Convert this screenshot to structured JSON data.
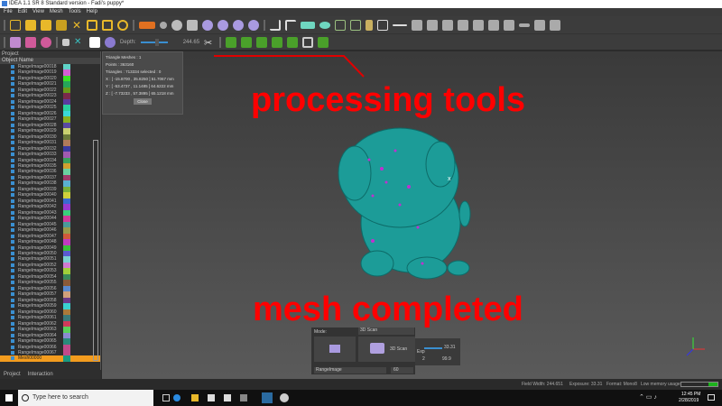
{
  "window": {
    "title": "IDEA 1.1 SR 8 Standard version - Fadi's puppy*"
  },
  "menu": [
    "File",
    "Edit",
    "View",
    "Mesh",
    "Tools",
    "Help"
  ],
  "toolbar2": {
    "depth_label": "Depth:",
    "depth_value": "244.65"
  },
  "project": {
    "header": "Project",
    "column": "Object Name",
    "items": [
      {
        "name": "RangeImage00018",
        "color": "#5fd3c8"
      },
      {
        "name": "RangeImage00019",
        "color": "#d45fd3"
      },
      {
        "name": "RangeImage00020",
        "color": "#3be026"
      },
      {
        "name": "RangeImage00021",
        "color": "#26a55a"
      },
      {
        "name": "RangeImage00022",
        "color": "#6a9a1a"
      },
      {
        "name": "RangeImage00023",
        "color": "#7a2a4a"
      },
      {
        "name": "RangeImage00024",
        "color": "#5a3aa0"
      },
      {
        "name": "RangeImage00025",
        "color": "#2ad0a0"
      },
      {
        "name": "RangeImage00026",
        "color": "#3ad8d8"
      },
      {
        "name": "RangeImage00027",
        "color": "#8ab020"
      },
      {
        "name": "RangeImage00028",
        "color": "#5a4aa0"
      },
      {
        "name": "RangeImage00029",
        "color": "#c8d070"
      },
      {
        "name": "RangeImage00030",
        "color": "#6a7a3a"
      },
      {
        "name": "RangeImage00031",
        "color": "#b07a5a"
      },
      {
        "name": "RangeImage00032",
        "color": "#3a3aa0"
      },
      {
        "name": "RangeImage00033",
        "color": "#a05ab0"
      },
      {
        "name": "RangeImage00034",
        "color": "#3aa05a"
      },
      {
        "name": "RangeImage00035",
        "color": "#d0a030"
      },
      {
        "name": "RangeImage00036",
        "color": "#6ad0a0"
      },
      {
        "name": "RangeImage00037",
        "color": "#a03a6a"
      },
      {
        "name": "RangeImage00038",
        "color": "#5ab0d0"
      },
      {
        "name": "RangeImage00039",
        "color": "#7ab03a"
      },
      {
        "name": "RangeImage00040",
        "color": "#d0d03a"
      },
      {
        "name": "RangeImage00041",
        "color": "#3a6ad0"
      },
      {
        "name": "RangeImage00042",
        "color": "#9a3ad0"
      },
      {
        "name": "RangeImage00043",
        "color": "#3ad07a"
      },
      {
        "name": "RangeImage00044",
        "color": "#d03a9a"
      },
      {
        "name": "RangeImage00045",
        "color": "#4a9a9a"
      },
      {
        "name": "RangeImage00046",
        "color": "#9a9a4a"
      },
      {
        "name": "RangeImage00047",
        "color": "#d05a3a"
      },
      {
        "name": "RangeImage00048",
        "color": "#c03ac0"
      },
      {
        "name": "RangeImage00049",
        "color": "#3ac03a"
      },
      {
        "name": "RangeImage00050",
        "color": "#5a5ad0"
      },
      {
        "name": "RangeImage00051",
        "color": "#7ad0d0"
      },
      {
        "name": "RangeImage00052",
        "color": "#d07ad0"
      },
      {
        "name": "RangeImage00053",
        "color": "#a0d03a"
      },
      {
        "name": "RangeImage00054",
        "color": "#3a8a5a"
      },
      {
        "name": "RangeImage00055",
        "color": "#8a5a3a"
      },
      {
        "name": "RangeImage00056",
        "color": "#5a8ad0"
      },
      {
        "name": "RangeImage00057",
        "color": "#d0a07a"
      },
      {
        "name": "RangeImage00058",
        "color": "#6a3a8a"
      },
      {
        "name": "RangeImage00059",
        "color": "#3ad0d0"
      },
      {
        "name": "RangeImage00060",
        "color": "#aa7a3a"
      },
      {
        "name": "RangeImage00061",
        "color": "#3a7a7a"
      },
      {
        "name": "RangeImage00062",
        "color": "#d03a5a"
      },
      {
        "name": "RangeImage00063",
        "color": "#5ad05a"
      },
      {
        "name": "RangeImage00064",
        "color": "#8a8ad0"
      },
      {
        "name": "RangeImage00065",
        "color": "#2a8a7a"
      },
      {
        "name": "RangeImage00066",
        "color": "#c04a8a"
      },
      {
        "name": "RangeImage00067",
        "color": "#c04a8a"
      },
      {
        "name": "Mesh00000",
        "color": "#1a9a80",
        "selected": true
      }
    ],
    "tabs": [
      "Project",
      "Interaction"
    ]
  },
  "info": {
    "triangle_meshes": "Triangle Meshes :   1",
    "points": "Points :      363160",
    "triangles": "Triangles :   713334   selected :  0",
    "x": "X :  [ -15.8700 , 35.8250 ]  51.7067 mm",
    "y": "Y :  [ -53.4737 , 11.1485 ]  64.6222 mm",
    "z": "Z :  [ -7.73233 , 57.3895 ]  65.1218 mm",
    "close": "Close"
  },
  "annotations": {
    "top": "processing tools",
    "bottom": "mesh completed"
  },
  "scan": {
    "mode_label": "Mode:",
    "mode": "3D Scan",
    "scan_btn": "3D Scan",
    "exp_label": "Exp",
    "exp_value": "33.31",
    "exp_min": "2",
    "exp_max": "99.9",
    "image_type": "RangeImage",
    "count": "60"
  },
  "status": {
    "field_width": "Field Width: 244.651",
    "exposure": "Exposure: 33.31",
    "format": "Format: Mono8",
    "memory": "Low memory usage",
    "memory_fraction": 0.25
  },
  "taskbar": {
    "search": "Type here to search",
    "time": "12:45 PM",
    "date": "2/28/2019"
  }
}
